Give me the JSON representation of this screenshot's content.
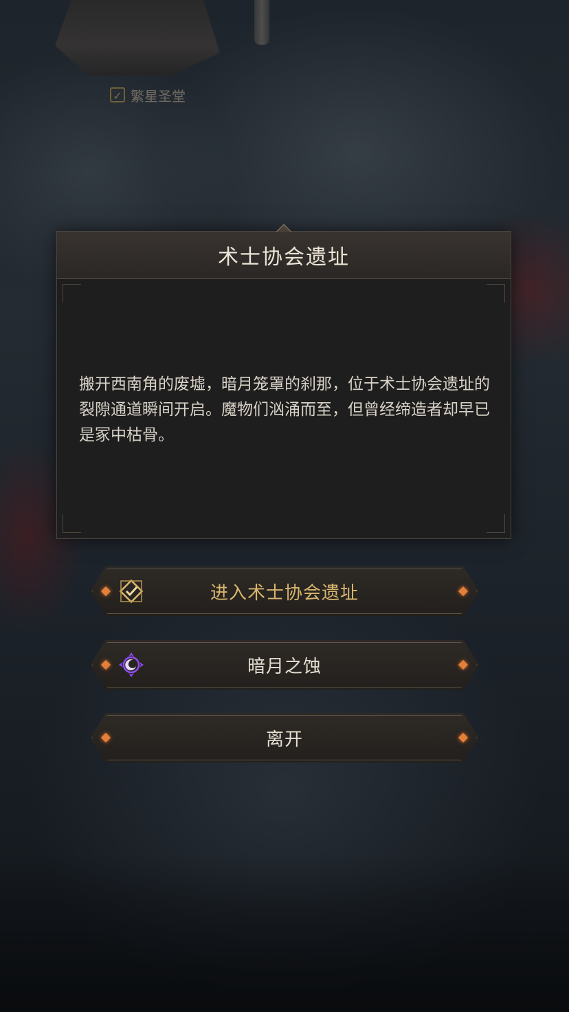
{
  "map": {
    "location_label": "繁星圣堂"
  },
  "dialog": {
    "title": "术士协会遗址",
    "body": "搬开西南角的废墟，暗月笼罩的刹那，位于术士协会遗址的裂隙通道瞬间开启。魔物们汹涌而至，但曾经缔造者却早已是冢中枯骨。"
  },
  "buttons": [
    {
      "label": "进入术士协会遗址",
      "icon": "gold-diamond-check-icon",
      "color": "#d9b66e"
    },
    {
      "label": "暗月之蚀",
      "icon": "purple-crescent-moon-icon",
      "color": "#e6dfd2"
    },
    {
      "label": "离开",
      "icon": null,
      "color": "#e6dfd2"
    }
  ],
  "colors": {
    "accent_orange": "#e0803a",
    "moon_purple": "#8f4bf0",
    "gold": "#d9b66e"
  }
}
